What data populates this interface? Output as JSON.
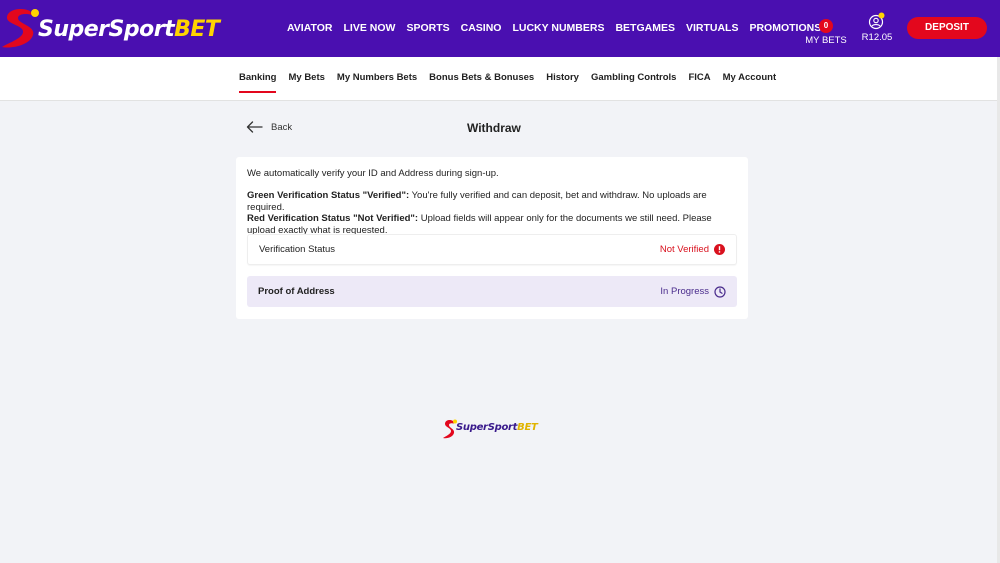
{
  "brand": {
    "name_part1": "SuperSport",
    "name_part2": "BET",
    "primary_color": "#4a0fb0",
    "accent_color": "#e3071d",
    "highlight_color": "#ffd400"
  },
  "main_nav": [
    "AVIATOR",
    "LIVE NOW",
    "SPORTS",
    "CASINO",
    "LUCKY NUMBERS",
    "BETGAMES",
    "VIRTUALS",
    "PROMOTIONS"
  ],
  "header": {
    "my_bets_count": "0",
    "my_bets_label": "MY BETS",
    "balance": "R12.05",
    "deposit_label": "DEPOSIT"
  },
  "sub_nav": {
    "active": "Banking",
    "items": [
      "Banking",
      "My Bets",
      "My Numbers Bets",
      "Bonus Bets & Bonuses",
      "History",
      "Gambling Controls",
      "FICA",
      "My Account"
    ]
  },
  "page": {
    "back_label": "Back",
    "title": "Withdraw"
  },
  "verification": {
    "intro": "We automatically verify your ID and Address during sign-up.",
    "green_title": "Green Verification Status \"Verified\":",
    "green_text": " You're fully verified and can deposit, bet and withdraw. No uploads are required.",
    "red_title": "Red Verification Status \"Not Verified\":",
    "red_text": " Upload fields will appear only for the documents we still need. Please upload exactly what is requested.",
    "rows": [
      {
        "label": "Verification Status",
        "status": "Not Verified",
        "status_icon": "alert-circle-icon",
        "status_color": "#d9111e"
      },
      {
        "label": "Proof of Address",
        "status": "In Progress",
        "status_icon": "clock-icon",
        "status_color": "#4a2c8c"
      }
    ]
  }
}
